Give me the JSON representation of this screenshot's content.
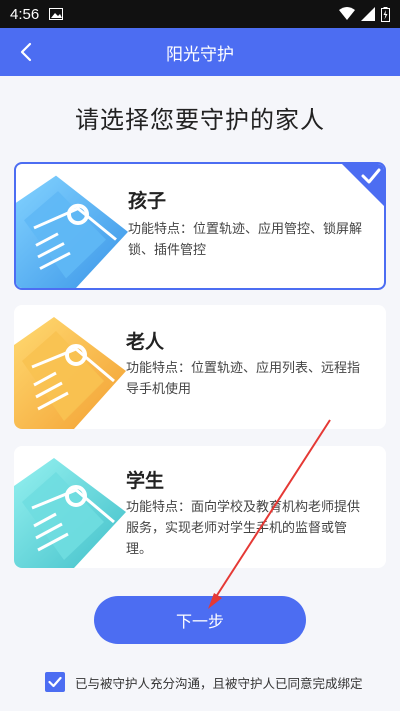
{
  "status_bar": {
    "time": "4:56",
    "icons": [
      "image-icon",
      "wifi-icon",
      "signal-icon",
      "battery-icon"
    ]
  },
  "nav": {
    "title": "阳光守护",
    "back_icon": "chevron-left-icon"
  },
  "heading": "请选择您要守护的家人",
  "options": [
    {
      "name": "孩子",
      "desc": "功能特点：位置轨迹、应用管控、锁屏解锁、插件管控",
      "color": "#3ea4f0",
      "selected": true
    },
    {
      "name": "老人",
      "desc": "功能特点：位置轨迹、应用列表、远程指导手机使用",
      "color": "#f7b43c",
      "selected": false
    },
    {
      "name": "学生",
      "desc": "功能特点：面向学校及教育机构老师提供服务，实现老师对学生手机的监督或管理。",
      "color": "#5ad3d8",
      "selected": false
    }
  ],
  "next_button": "下一步",
  "agreement": {
    "checked": true,
    "text": "已与被守护人充分沟通，且被守护人已同意完成绑定"
  },
  "colors": {
    "accent": "#4c6df2",
    "status_bar": "#111111",
    "background": "#f5f6fa",
    "annotation_arrow": "#e53935"
  }
}
